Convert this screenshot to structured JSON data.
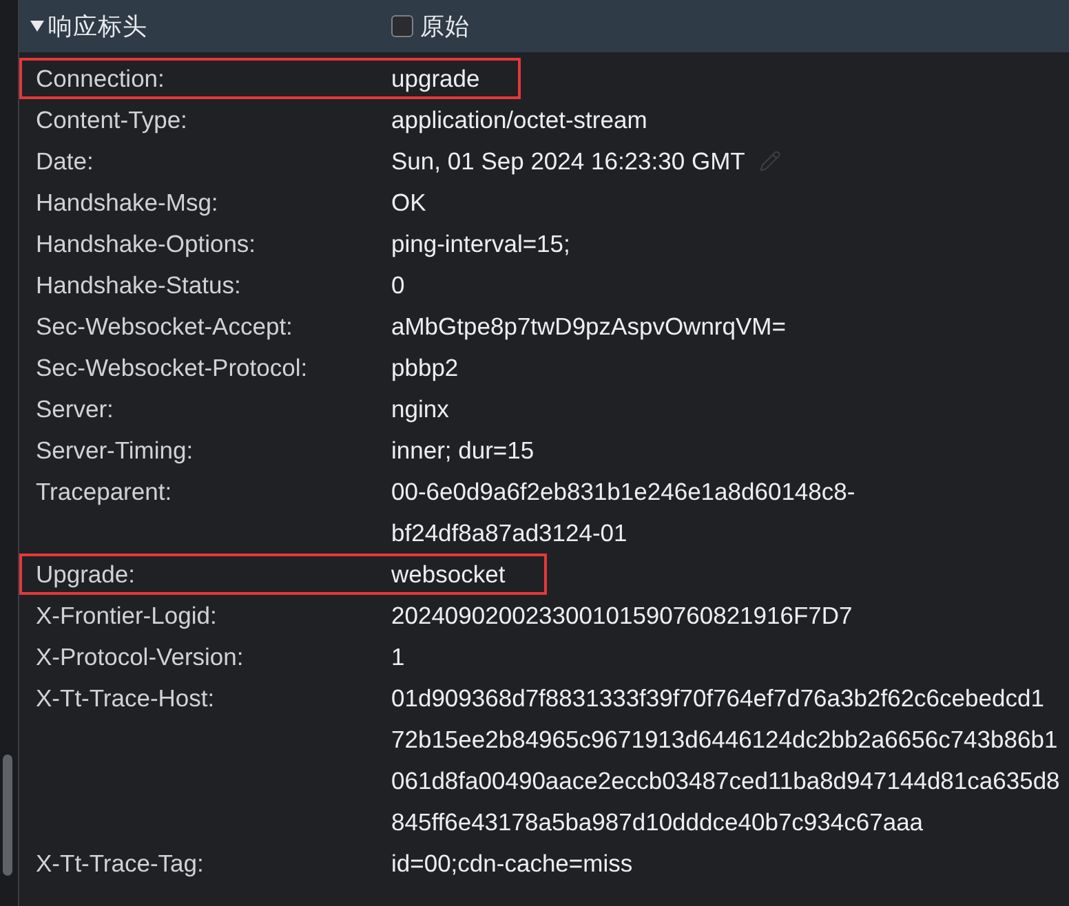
{
  "panel": {
    "title": "响应标头",
    "expanded": true,
    "raw_checkbox": {
      "label": "原始",
      "checked": false
    }
  },
  "headers": [
    {
      "name": "Connection:",
      "value_lines": [
        "upgrade"
      ],
      "highlighted": true,
      "hovered": false
    },
    {
      "name": "Content-Type:",
      "value_lines": [
        "application/octet-stream"
      ],
      "highlighted": false,
      "hovered": false
    },
    {
      "name": "Date:",
      "value_lines": [
        "Sun, 01 Sep 2024 16:23:30 GMT"
      ],
      "highlighted": false,
      "hovered": true
    },
    {
      "name": "Handshake-Msg:",
      "value_lines": [
        "OK"
      ],
      "highlighted": false,
      "hovered": false
    },
    {
      "name": "Handshake-Options:",
      "value_lines": [
        "ping-interval=15;"
      ],
      "highlighted": false,
      "hovered": false
    },
    {
      "name": "Handshake-Status:",
      "value_lines": [
        "0"
      ],
      "highlighted": false,
      "hovered": false
    },
    {
      "name": "Sec-Websocket-Accept:",
      "value_lines": [
        "aMbGtpe8p7twD9pzAspvOwnrqVM="
      ],
      "highlighted": false,
      "hovered": false
    },
    {
      "name": "Sec-Websocket-Protocol:",
      "value_lines": [
        "pbbp2"
      ],
      "highlighted": false,
      "hovered": false
    },
    {
      "name": "Server:",
      "value_lines": [
        "nginx"
      ],
      "highlighted": false,
      "hovered": false
    },
    {
      "name": "Server-Timing:",
      "value_lines": [
        "inner; dur=15"
      ],
      "highlighted": false,
      "hovered": false
    },
    {
      "name": "Traceparent:",
      "value_lines": [
        "00-6e0d9a6f2eb831b1e246e1a8d60148c8-",
        "bf24df8a87ad3124-01"
      ],
      "highlighted": false,
      "hovered": false
    },
    {
      "name": "Upgrade:",
      "value_lines": [
        "websocket"
      ],
      "highlighted": true,
      "hovered": false
    },
    {
      "name": "X-Frontier-Logid:",
      "value_lines": [
        "202409020023300101590760821916F7D7"
      ],
      "highlighted": false,
      "hovered": false
    },
    {
      "name": "X-Protocol-Version:",
      "value_lines": [
        "1"
      ],
      "highlighted": false,
      "hovered": false
    },
    {
      "name": "X-Tt-Trace-Host:",
      "value_lines": [
        "01d909368d7f8831333f39f70f764ef7d76a3b2f62c6cebedcd1",
        "72b15ee2b84965c9671913d6446124dc2bb2a6656c743b86b1",
        "061d8fa00490aace2eccb03487ced11ba8d947144d81ca635d8",
        "845ff6e43178a5ba987d10dddce40b7c934c67aaa"
      ],
      "highlighted": false,
      "hovered": false
    },
    {
      "name": "X-Tt-Trace-Tag:",
      "value_lines": [
        "id=00;cdn-cache=miss"
      ],
      "highlighted": false,
      "hovered": false
    }
  ]
}
